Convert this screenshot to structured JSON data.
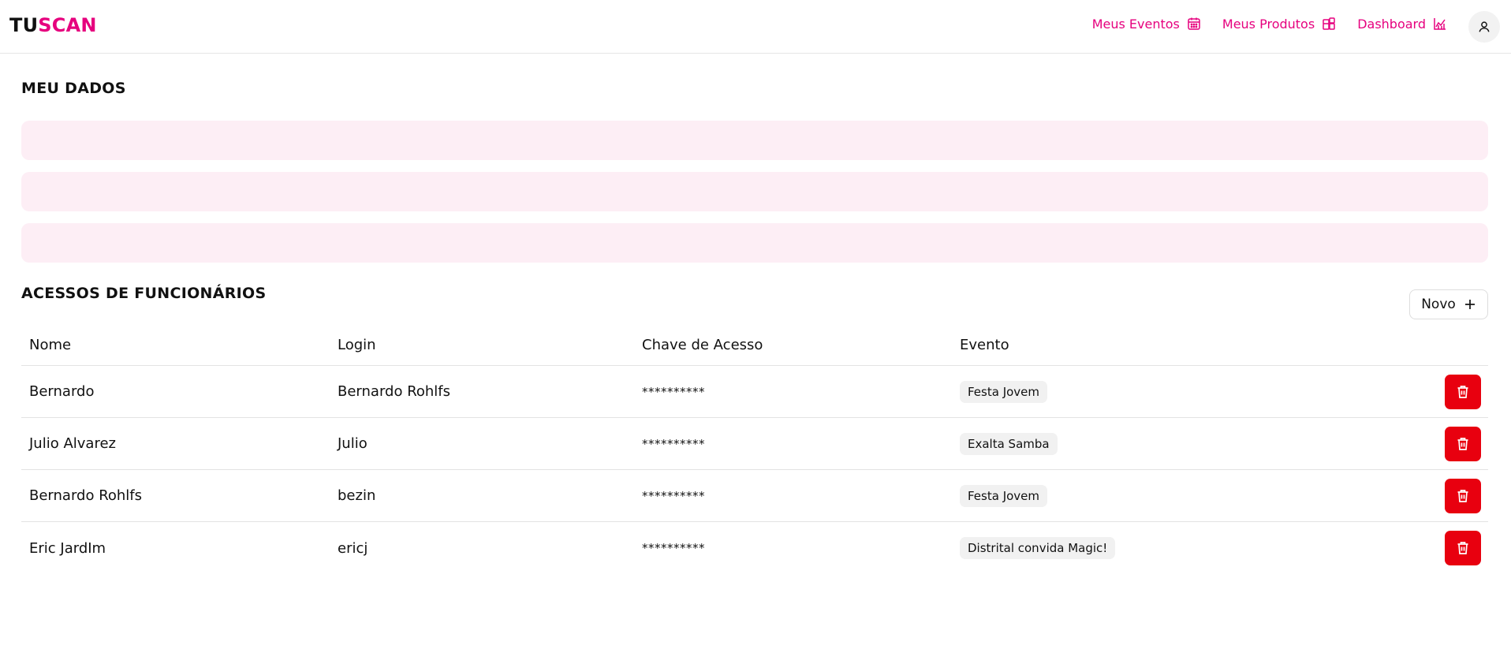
{
  "app": {
    "logo_part1": "TU",
    "logo_part2": "SCAN"
  },
  "nav": {
    "items": [
      {
        "label": "Meus Eventos",
        "icon": "calendar-icon"
      },
      {
        "label": "Meus Produtos",
        "icon": "grid-plus-icon"
      },
      {
        "label": "Dashboard",
        "icon": "chart-icon"
      }
    ],
    "avatar_icon": "user-icon"
  },
  "colors": {
    "brand": "#e6007e",
    "pink_light": "#fdeef5",
    "danger": "#e8000f"
  },
  "meus_dados": {
    "title": "MEU DADOS"
  },
  "acessos": {
    "title": "ACESSOS DE FUNCIONÁRIOS",
    "novo_label": "Novo",
    "headers": {
      "nome": "Nome",
      "login": "Login",
      "chave": "Chave de Acesso",
      "evento": "Evento"
    },
    "rows": [
      {
        "nome": "Bernardo",
        "login": "Bernardo Rohlfs",
        "chave": "**********",
        "evento": "Festa Jovem"
      },
      {
        "nome": "Julio Alvarez",
        "login": "Julio",
        "chave": "**********",
        "evento": "Exalta Samba"
      },
      {
        "nome": "Bernardo Rohlfs",
        "login": "bezin",
        "chave": "**********",
        "evento": "Festa Jovem"
      },
      {
        "nome": "Eric JardIm",
        "login": "ericj",
        "chave": "**********",
        "evento": "Distrital convida Magic!"
      }
    ]
  }
}
